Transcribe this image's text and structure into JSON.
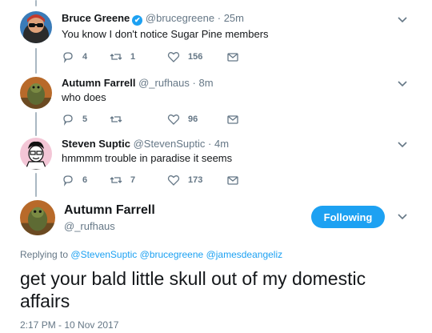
{
  "tweets": [
    {
      "name": "Bruce Greene",
      "verified_badge": "✔",
      "handle": "@brucegreene",
      "separator": "·",
      "time": "25m",
      "text": "You know I don't notice Sugar Pine members",
      "replies": "4",
      "retweets": "1",
      "likes": "156"
    },
    {
      "name": "Autumn Farrell",
      "handle": "@_rufhaus",
      "separator": "·",
      "time": "8m",
      "text": "who does",
      "replies": "5",
      "retweets": "",
      "likes": "96"
    },
    {
      "name": "Steven Suptic",
      "handle": "@StevenSuptic",
      "separator": "·",
      "time": "4m",
      "text": "hmmmm trouble in paradise it seems",
      "replies": "6",
      "retweets": "7",
      "likes": "173"
    }
  ],
  "main_tweet": {
    "name": "Autumn Farrell",
    "handle": "@_rufhaus",
    "follow_label": "Following",
    "replying_prefix": "Replying to",
    "replying_to": [
      "@StevenSuptic",
      "@brucegreene",
      "@jamesdeangeliz"
    ],
    "text": "get your bald little skull out of my domestic affairs",
    "timestamp": "2:17 PM - 10 Nov 2017"
  },
  "icons": [
    "reply-icon",
    "retweet-icon",
    "like-icon",
    "dm-icon",
    "chevron-down-icon",
    "verified-icon"
  ],
  "colors": {
    "accent": "#1da1f2",
    "text": "#14171a",
    "muted": "#657786",
    "thread_line": "#aab8c2"
  }
}
